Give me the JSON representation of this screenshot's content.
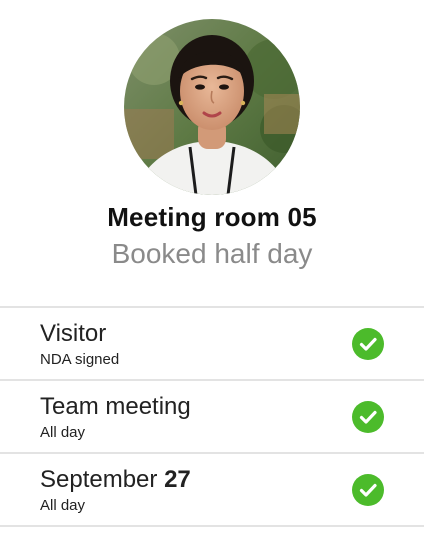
{
  "profile": {
    "avatar_icon": "person-photo",
    "title": "Meeting room 05",
    "subtitle": "Booked half day"
  },
  "items": [
    {
      "label": "Visitor",
      "label_bold": "",
      "sub": "NDA signed",
      "status_icon": "check-circle-icon"
    },
    {
      "label": "Team meeting",
      "label_bold": "",
      "sub": "All day",
      "status_icon": "check-circle-icon"
    },
    {
      "label": "September ",
      "label_bold": "27",
      "sub": "All day",
      "status_icon": "check-circle-icon"
    }
  ],
  "colors": {
    "check": "#4cbb2b",
    "subtitle": "#8a8a8a",
    "divider": "#e3e3e3"
  }
}
